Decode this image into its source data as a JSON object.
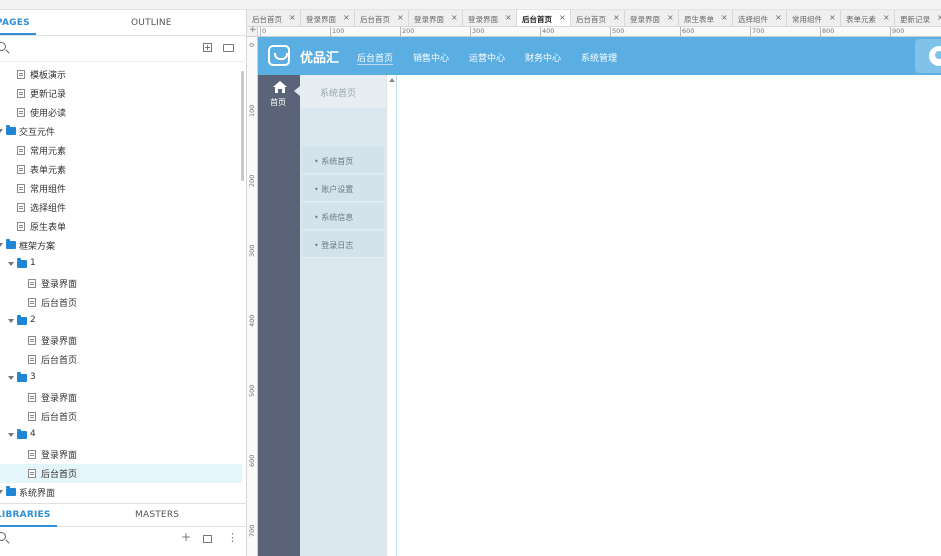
{
  "left_panel": {
    "tabs": {
      "pages": "PAGES",
      "outline": "OUTLINE"
    },
    "tree": [
      {
        "type": "page",
        "label": "模板演示",
        "level": 1
      },
      {
        "type": "page",
        "label": "更新记录",
        "level": 1
      },
      {
        "type": "page",
        "label": "使用必读",
        "level": 1
      },
      {
        "type": "folder",
        "label": "交互元件",
        "level": 0
      },
      {
        "type": "page",
        "label": "常用元素",
        "level": 1
      },
      {
        "type": "page",
        "label": "表单元素",
        "level": 1
      },
      {
        "type": "page",
        "label": "常用组件",
        "level": 1
      },
      {
        "type": "page",
        "label": "选择组件",
        "level": 1
      },
      {
        "type": "page",
        "label": "原生表单",
        "level": 1
      },
      {
        "type": "folder",
        "label": "框架方案",
        "level": 0
      },
      {
        "type": "folder",
        "label": "1",
        "level": 1
      },
      {
        "type": "page",
        "label": "登录界面",
        "level": 2
      },
      {
        "type": "page",
        "label": "后台首页",
        "level": 2
      },
      {
        "type": "folder",
        "label": "2",
        "level": 1
      },
      {
        "type": "page",
        "label": "登录界面",
        "level": 2
      },
      {
        "type": "page",
        "label": "后台首页",
        "level": 2
      },
      {
        "type": "folder",
        "label": "3",
        "level": 1
      },
      {
        "type": "page",
        "label": "登录界面",
        "level": 2
      },
      {
        "type": "page",
        "label": "后台首页",
        "level": 2
      },
      {
        "type": "folder",
        "label": "4",
        "level": 1
      },
      {
        "type": "page",
        "label": "登录界面",
        "level": 2
      },
      {
        "type": "page",
        "label": "后台首页",
        "level": 2,
        "selected": true
      },
      {
        "type": "folder",
        "label": "系统界面",
        "level": 0
      }
    ],
    "library_tabs": {
      "libraries": "LIBRARIES",
      "masters": "MASTERS"
    }
  },
  "doc_tabs": [
    {
      "label": "后台首页"
    },
    {
      "label": "登录界面"
    },
    {
      "label": "后台首页"
    },
    {
      "label": "登录界面"
    },
    {
      "label": "登录界面"
    },
    {
      "label": "后台首页",
      "active": true
    },
    {
      "label": "后台首页"
    },
    {
      "label": "登录界面"
    },
    {
      "label": "原生表单"
    },
    {
      "label": "选择组件"
    },
    {
      "label": "常用组件"
    },
    {
      "label": "表单元素"
    },
    {
      "label": "更新记录"
    }
  ],
  "rulers": {
    "horizontal": [
      "0",
      "100",
      "200",
      "300",
      "400",
      "500",
      "600",
      "700",
      "800",
      "900"
    ],
    "vertical": [
      "0",
      "100",
      "200",
      "300",
      "400",
      "500",
      "600",
      "700"
    ]
  },
  "mockup": {
    "brand": "优品汇",
    "nav": [
      "后台首页",
      "销售中心",
      "运营中心",
      "财务中心",
      "系统管理"
    ],
    "home_label": "首页",
    "submenu_title": "系统首页",
    "submenu_items": [
      "• 系统首页",
      "• 账户设置",
      "• 系统信息",
      "• 登录日志"
    ],
    "colors": {
      "header": "#5aaee2",
      "sidebar": "#5a6378",
      "submenu": "#dbe7ee",
      "accent": "#2f8ed8"
    }
  }
}
